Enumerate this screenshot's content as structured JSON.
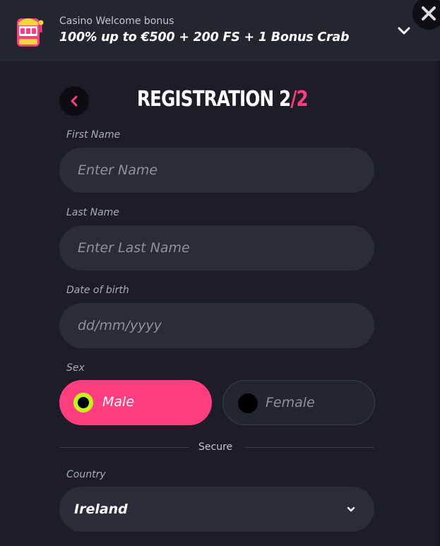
{
  "banner": {
    "subtitle": "Casino Welcome bonus",
    "title": "100% up to €500 + 200 FS + 1 Bonus Crab",
    "icon": "slot-machine-icon",
    "expand_icon": "chevron-down-icon",
    "close_icon": "close-icon"
  },
  "header": {
    "title": "REGISTRATION",
    "step_current": "2",
    "step_separator": "/",
    "step_total": "2",
    "back_icon": "chevron-left-icon"
  },
  "form": {
    "first_name": {
      "label": "First Name",
      "placeholder": "Enter Name",
      "value": ""
    },
    "last_name": {
      "label": "Last Name",
      "placeholder": "Enter Last Name",
      "value": ""
    },
    "date_of_birth": {
      "label": "Date of birth",
      "placeholder": "dd/mm/yyyy",
      "value": ""
    },
    "sex": {
      "label": "Sex",
      "options": [
        {
          "label": "Male",
          "selected": true
        },
        {
          "label": "Female",
          "selected": false
        }
      ]
    },
    "divider_label": "Secure",
    "country": {
      "label": "Country",
      "value": "Ireland"
    }
  },
  "colors": {
    "accent": "#ff3d7f",
    "radio_ring": "#c6f21a",
    "background": "#1c1d26",
    "input_bg": "#2a2c37"
  }
}
